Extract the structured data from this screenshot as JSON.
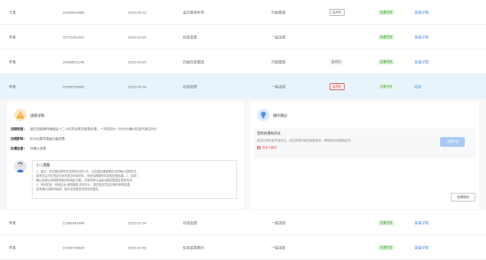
{
  "rows_top": [
    {
      "name": "王某",
      "id": "23185634456",
      "date": "2023-04-13",
      "event": "会员登录异常",
      "rule": "市级管理",
      "risk": "高风险",
      "risk_style": "gray",
      "status": "处置完成",
      "action": "查看详情"
    },
    {
      "name": "李某",
      "id": "22731351922",
      "date": "2023-03-25",
      "event": "信息变更",
      "rule": "一般违规",
      "risk": "",
      "risk_style": "",
      "status": "处置完成",
      "action": "查看详情"
    },
    {
      "name": "李某",
      "id": "23083621146",
      "date": "2023-03-25",
      "event": "页面信息篡改",
      "rule": "市级管理",
      "risk": "高风险",
      "risk_style": "gray",
      "status": "处置完成",
      "action": "查看详情"
    },
    {
      "name": "李某",
      "id": "22459750992",
      "date": "2023-04-18",
      "event": "信息变更",
      "rule": "一般违规",
      "risk": "高风险",
      "risk_style": "red",
      "status": "处置完成",
      "action": "收起"
    }
  ],
  "detail": {
    "left_title": "违规详情",
    "left_lines": [
      {
        "label": "违规原因：",
        "text": "超过违规操作阈值后十二小时内未再次登录处理，一次性扣分（50分为满分扣至不超过0分）"
      },
      {
        "label": "违规影响：",
        "text": "扣分后暂停高级功能权限"
      },
      {
        "label": "处理进度：",
        "text": "待确认违规"
      }
    ],
    "assistant_title": "小二提醒",
    "assistant_text": [
      "1、建议：您店铺近期存在高风险交易行为，请加强店铺管理并及时确认违规情况，",
      "若有异议可在规定时间内提交申诉材料，系统将根据材料复核处理结果。2、影响：",
      "确认违规后将按照规则扣除相应分数，并暂停部分高级功能权限直至整改完成。",
      "3、申诉渠道：商家后台-违规管理-申诉中心，提交相关凭证后等待审核结果。",
      "如有疑问请联系客服，我们将协助您尽快完成整改。"
    ],
    "right_title": "操作建议",
    "box_title": "您的处理有异议",
    "box_text": "如您对本次处罚有异议，请在有效时间内提起申诉，审核成功将撤销处罚。",
    "box_alert": "申诉已超时",
    "appeal_button": "立即申诉",
    "rules_link": "查看规则"
  },
  "rows_bottom": [
    {
      "name": "李某",
      "id": "21983341448",
      "date": "2023-02-14",
      "event": "信息变更",
      "rule": "一般违规",
      "risk": "",
      "risk_style": "",
      "status": "处置完成",
      "action": "查看详情"
    },
    {
      "name": "李某",
      "id": "21993733928",
      "date": "2023-02-06",
      "event": "信息变更备份",
      "rule": "一般违规",
      "risk": "",
      "risk_style": "",
      "status": "处置完成",
      "action": "查看详情"
    }
  ],
  "colors": {
    "accent_blue": "#4f8fe8",
    "highlight_row": "#e8f4fc",
    "success_green": "#3a9b2f",
    "danger_red": "#d33"
  }
}
